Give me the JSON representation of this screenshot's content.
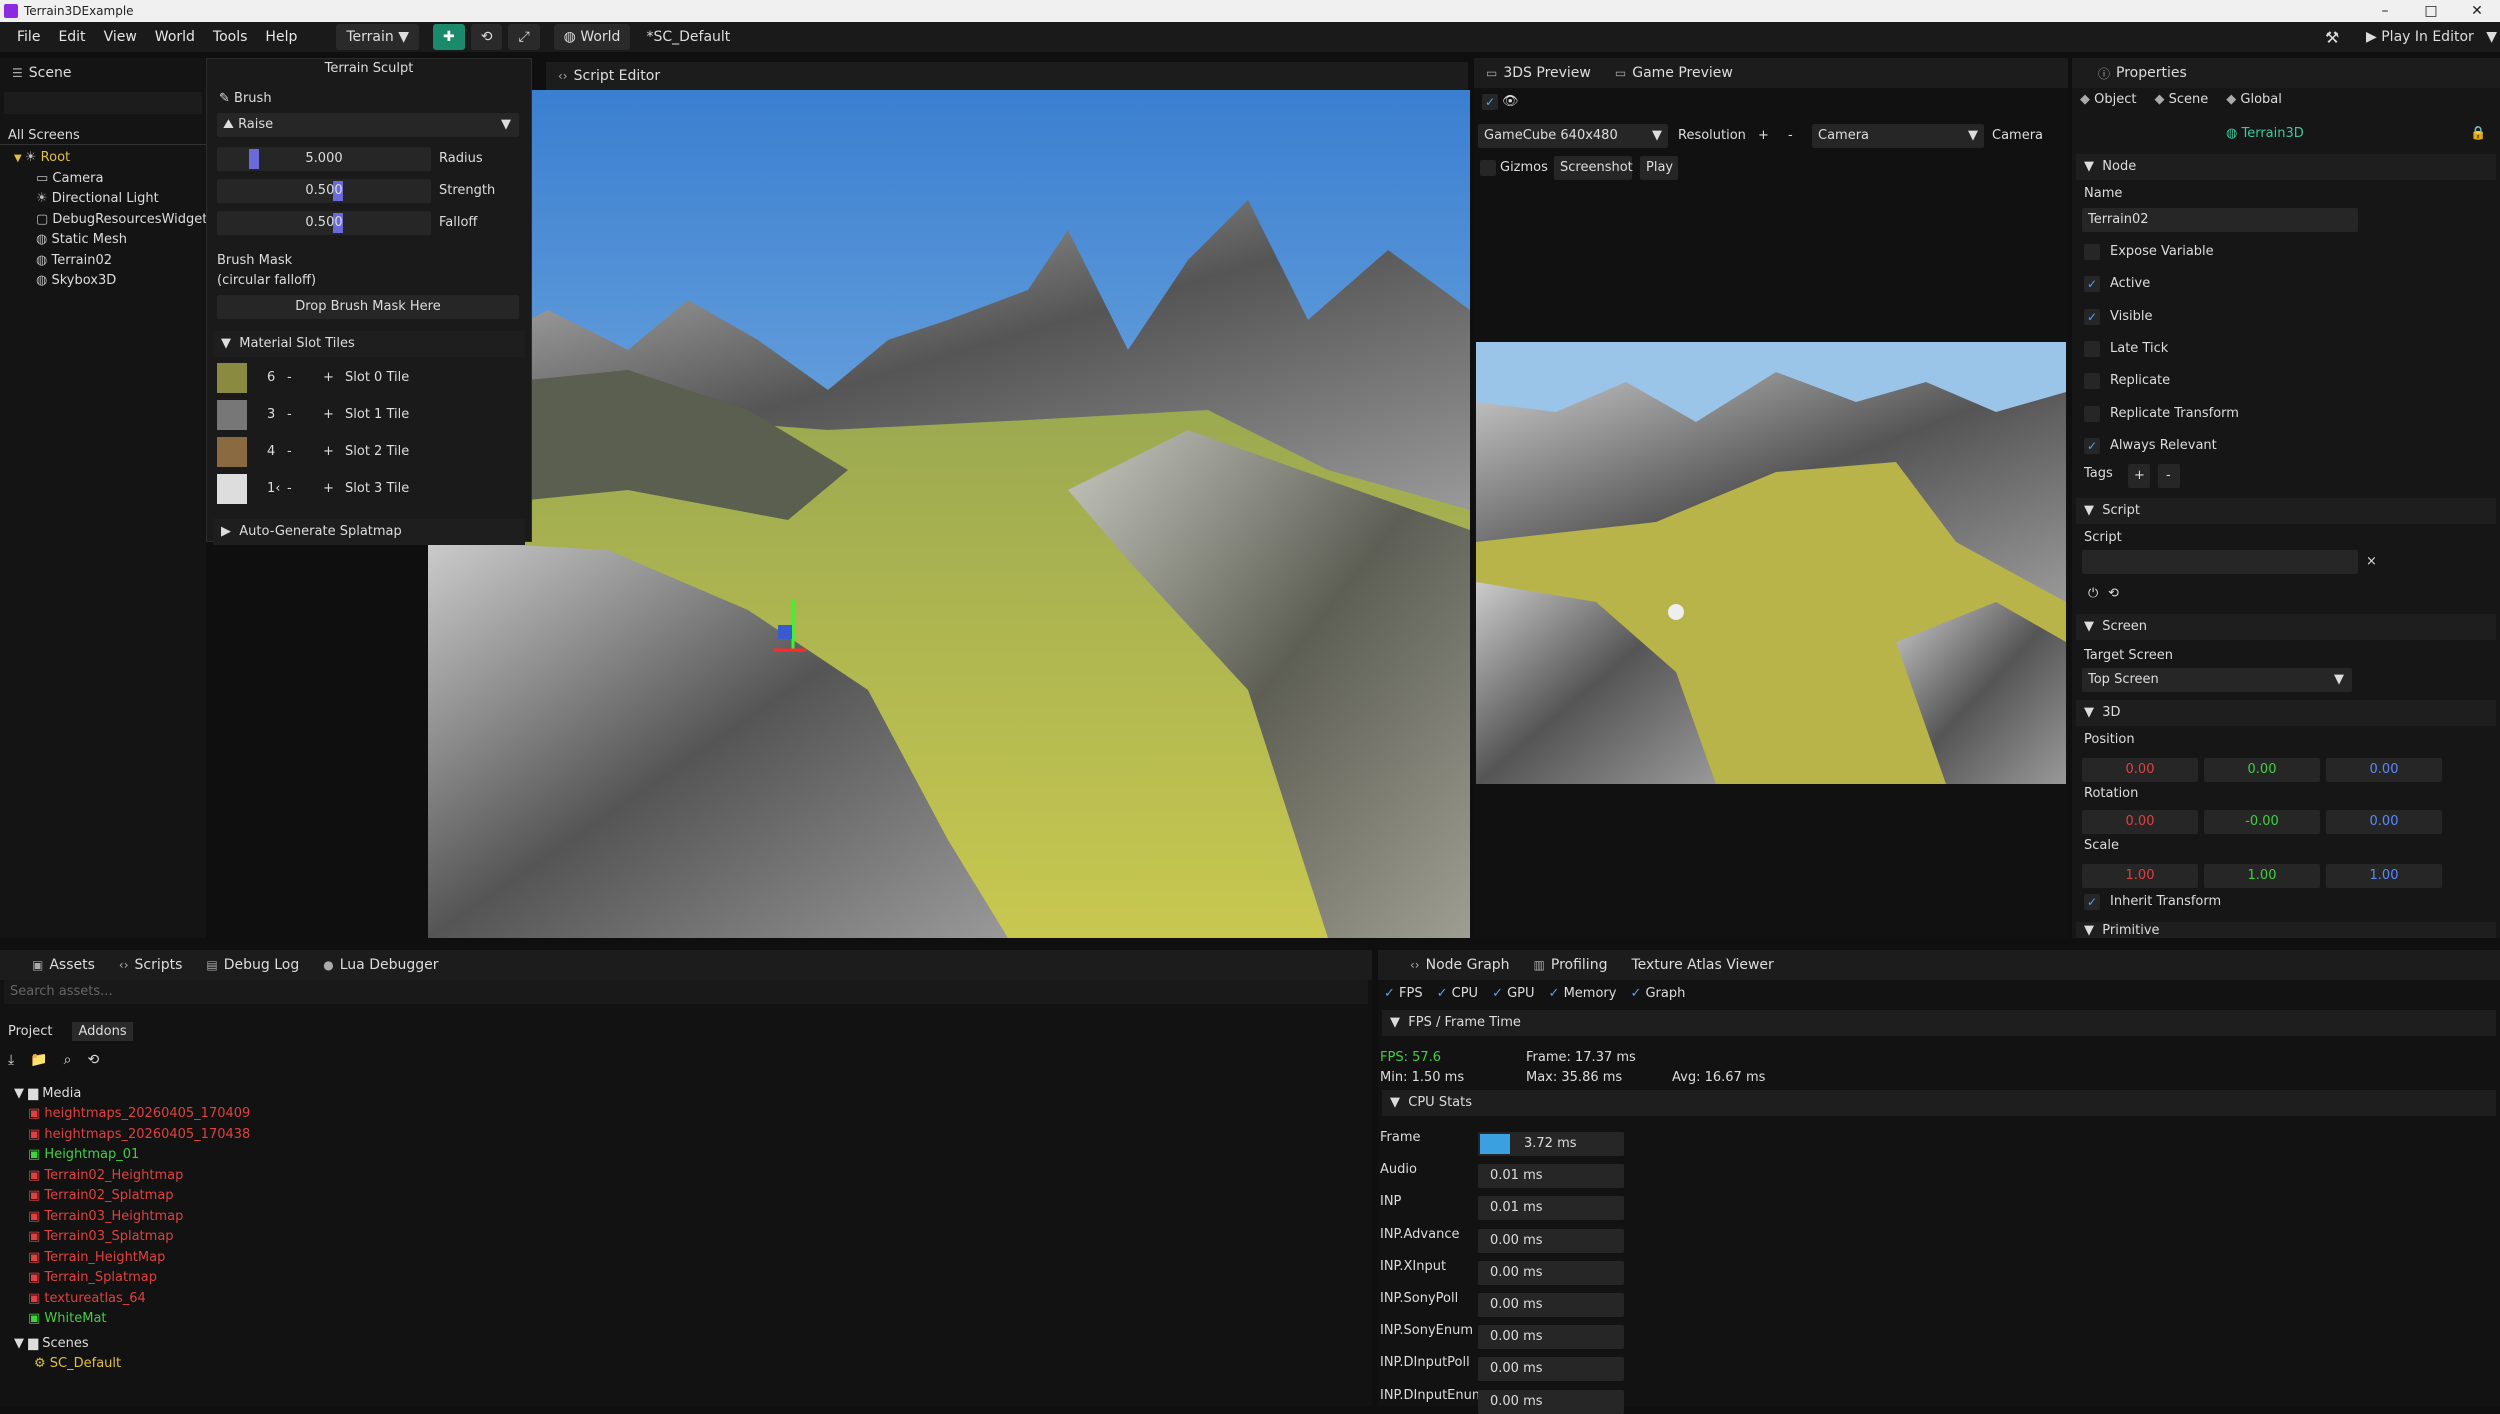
{
  "window": {
    "title": "Terrain3DExample",
    "min": "–",
    "max": "□",
    "close": "✕"
  },
  "menu": [
    "File",
    "Edit",
    "View",
    "World",
    "Tools",
    "Help"
  ],
  "toolbar": {
    "mode": "Terrain",
    "world": "World",
    "scene": "*SC_Default",
    "play": "Play In Editor"
  },
  "scene_panel": {
    "tab": "Scene",
    "all_screens": "All Screens",
    "tree": [
      {
        "label": "Root",
        "depth": 0,
        "icon": "root-icon"
      },
      {
        "label": "Camera",
        "depth": 1,
        "icon": "camera-icon"
      },
      {
        "label": "Directional Light",
        "depth": 1,
        "icon": "light-icon"
      },
      {
        "label": "DebugResourcesWidget",
        "depth": 1,
        "icon": "widget-icon"
      },
      {
        "label": "Static Mesh",
        "depth": 1,
        "icon": "mesh-icon"
      },
      {
        "label": "Terrain02",
        "depth": 1,
        "icon": "terrain-icon"
      },
      {
        "label": "Skybox3D",
        "depth": 1,
        "icon": "skybox-icon"
      }
    ]
  },
  "sculpt": {
    "title": "Terrain Sculpt",
    "brush_header": "Brush",
    "brush_mode": "Raise",
    "params": [
      {
        "value": "5.000",
        "label": "Radius",
        "level": 0.08
      },
      {
        "value": "0.500",
        "label": "Strength",
        "level": 0.5
      },
      {
        "value": "0.500",
        "label": "Falloff",
        "level": 0.5
      }
    ],
    "mask_label": "Brush Mask",
    "mask_sub": "(circular falloff)",
    "drop": "Drop Brush Mask Here",
    "slot_header": "Material Slot Tiles",
    "slots": [
      {
        "n": "6",
        "label": "Slot 0 Tile",
        "color": "#8a8a40"
      },
      {
        "n": "3",
        "label": "Slot 1 Tile",
        "color": "#777777"
      },
      {
        "n": "4",
        "label": "Slot 2 Tile",
        "color": "#8a6a40"
      },
      {
        "n": "1‹",
        "label": "Slot 3 Tile",
        "color": "#dddddd"
      }
    ],
    "auto": "Auto-Generate Splatmap",
    "minus": "-",
    "plus": "+"
  },
  "script_editor": {
    "tab": "Script Editor"
  },
  "preview": {
    "tab1": "3DS Preview",
    "tab2": "Game Preview",
    "device": "GameCube  640x480",
    "resolution": "Resolution",
    "plus": "+",
    "minus": "-",
    "camera_sel": "Camera",
    "camera_label": "Camera",
    "gizmos": "Gizmos",
    "screenshot": "Screenshot",
    "play": "Play"
  },
  "props": {
    "tab": "Properties",
    "tabs": [
      "Object",
      "Scene",
      "Global"
    ],
    "node_name": "Terrain3D",
    "node_header": "Node",
    "name_label": "Name",
    "name_value": "Terrain02",
    "checks": [
      {
        "label": "Expose Variable",
        "on": false
      },
      {
        "label": "Active",
        "on": true
      },
      {
        "label": "Visible",
        "on": true
      },
      {
        "label": "Late Tick",
        "on": false
      },
      {
        "label": "Replicate",
        "on": false
      },
      {
        "label": "Replicate Transform",
        "on": false
      },
      {
        "label": "Always Relevant",
        "on": true
      }
    ],
    "tags": "Tags",
    "tag_plus": "+",
    "tag_minus": "-",
    "script_header": "Script",
    "script_label": "Script",
    "clear": "×",
    "screen_header": "Screen",
    "target_label": "Target Screen",
    "target_value": "Top Screen",
    "d3_header": "3D",
    "position": "Position",
    "pos": [
      "0.00",
      "0.00",
      "0.00"
    ],
    "rotation": "Rotation",
    "rot": [
      "0.00",
      "-0.00",
      "0.00"
    ],
    "scale": "Scale",
    "scl": [
      "1.00",
      "1.00",
      "1.00"
    ],
    "inherit": "Inherit Transform",
    "primitive": "Primitive"
  },
  "assets": {
    "tabs": [
      "Assets",
      "Scripts",
      "Debug Log",
      "Lua Debugger"
    ],
    "search": "Search assets...",
    "subtabs": [
      "Project",
      "Addons"
    ],
    "media": "Media",
    "items": [
      {
        "label": "heightmaps_20260405_170409",
        "c": "red"
      },
      {
        "label": "heightmaps_20260405_170438",
        "c": "red"
      },
      {
        "label": "Heightmap_01",
        "c": "green"
      },
      {
        "label": "Terrain02_Heightmap",
        "c": "red"
      },
      {
        "label": "Terrain02_Splatmap",
        "c": "red"
      },
      {
        "label": "Terrain03_Heightmap",
        "c": "red"
      },
      {
        "label": "Terrain03_Splatmap",
        "c": "red"
      },
      {
        "label": "Terrain_HeightMap",
        "c": "red"
      },
      {
        "label": "Terrain_Splatmap",
        "c": "red"
      },
      {
        "label": "textureatlas_64",
        "c": "red"
      },
      {
        "label": "WhiteMat",
        "c": "green"
      }
    ],
    "scenes": "Scenes",
    "scene_item": "SC_Default"
  },
  "profiler": {
    "tabs": [
      "Node Graph",
      "Profiling",
      "Texture Atlas Viewer"
    ],
    "toggles": [
      "FPS",
      "CPU",
      "GPU",
      "Memory",
      "Graph"
    ],
    "fps_header": "FPS / Frame Time",
    "fps": "FPS: 57.6",
    "frame": "Frame: 17.37 ms",
    "min": "Min: 1.50 ms",
    "max": "Max: 35.86 ms",
    "avg": "Avg: 16.67 ms",
    "cpu_header": "CPU Stats",
    "stats": [
      {
        "label": "Frame",
        "value": "3.72 ms",
        "bar": true
      },
      {
        "label": "Audio",
        "value": "0.01 ms"
      },
      {
        "label": "INP",
        "value": "0.01 ms"
      },
      {
        "label": "INP.Advance",
        "value": "0.00 ms"
      },
      {
        "label": "INP.XInput",
        "value": "0.00 ms"
      },
      {
        "label": "INP.SonyPoll",
        "value": "0.00 ms"
      },
      {
        "label": "INP.SonyEnum",
        "value": "0.00 ms"
      },
      {
        "label": "INP.DInputPoll",
        "value": "0.00 ms"
      },
      {
        "label": "INP.DInputEnum",
        "value": "0.00 ms"
      }
    ]
  },
  "colors": {
    "accent": "#1a8a6a",
    "check": "#4da3ff",
    "red": "#e04040",
    "green": "#40d040",
    "blue": "#5a8aff",
    "frame_bar": "#3aa0e0"
  }
}
